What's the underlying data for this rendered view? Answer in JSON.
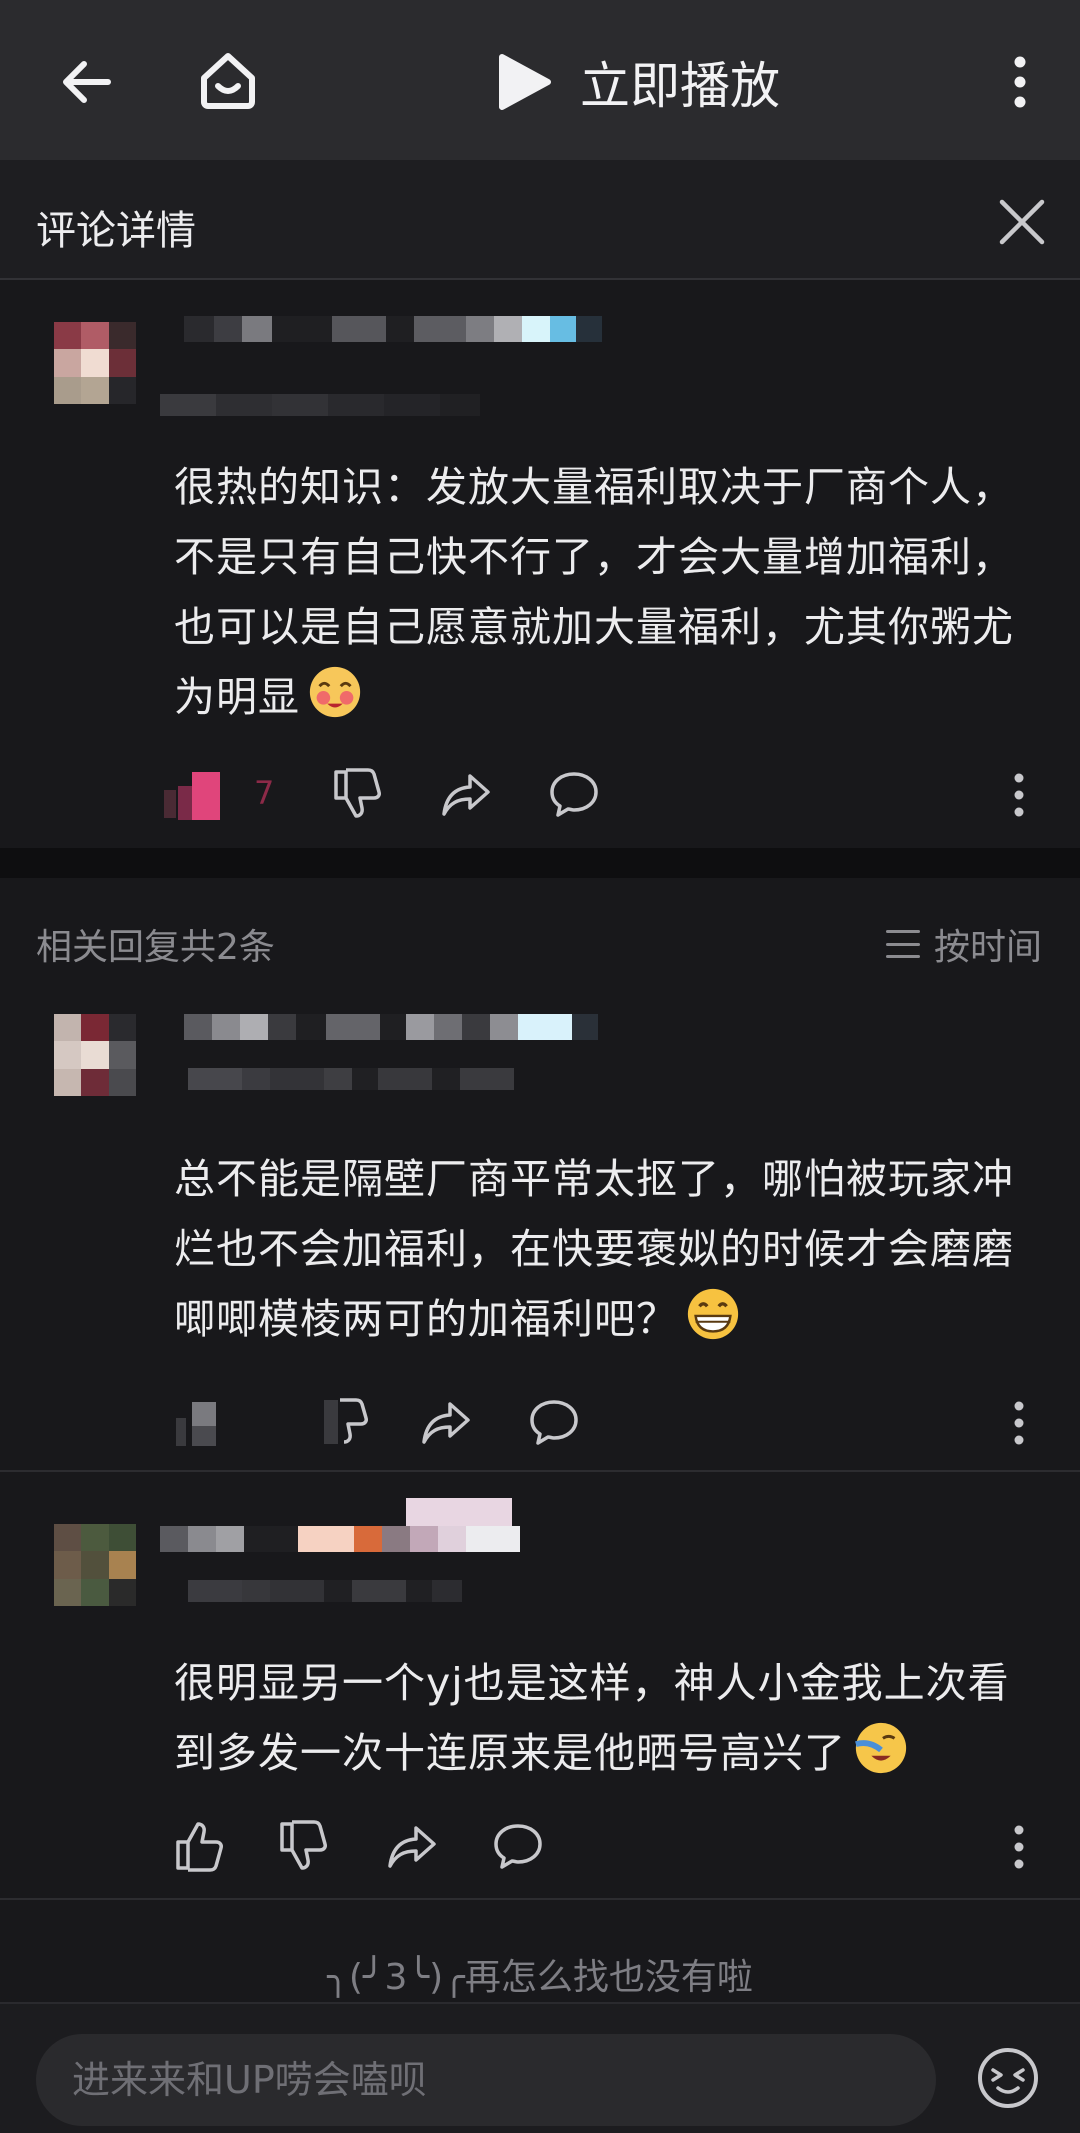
{
  "topbar": {
    "play_label": "立即播放"
  },
  "header": {
    "title": "评论详情"
  },
  "main_comment": {
    "text": "很热的知识：发放大量福利取决于厂商个人，不是只有自己快不行了，才会大量增加福利，也可以是自己愿意就加大量福利，尤其你粥尤为明显",
    "like_count": "7"
  },
  "replies": {
    "count_label": "相关回复共2条",
    "sort_label": "按时间",
    "items": [
      {
        "text": "总不能是隔壁厂商平常太抠了，哪怕被玩家冲烂也不会加福利，在快要褒姒的时候才会磨磨唧唧模棱两可的加福利吧？"
      },
      {
        "text": "很明显另一个yj也是这样，神人小金我上次看到多发一次十连原来是他晒号高兴了"
      }
    ]
  },
  "end_text": "╮(╯3╰)╭再怎么找也没有啦",
  "input": {
    "placeholder": "进来来和UP唠会嗑呗"
  },
  "icons": {
    "back": "arrow-left-icon",
    "home": "home-icon",
    "play": "play-icon",
    "more": "more-vertical-icon",
    "close": "close-icon",
    "like": "thumb-up-icon",
    "dislike": "thumb-down-icon",
    "share": "share-icon",
    "reply": "comment-bubble-icon",
    "sort": "sort-lines-icon",
    "emoji": "emoji-icon"
  },
  "colors": {
    "background": "#18181b",
    "topbar": "#2b2b2e",
    "liked_pink": "#e0457b",
    "muted_text": "#8b8b90"
  }
}
